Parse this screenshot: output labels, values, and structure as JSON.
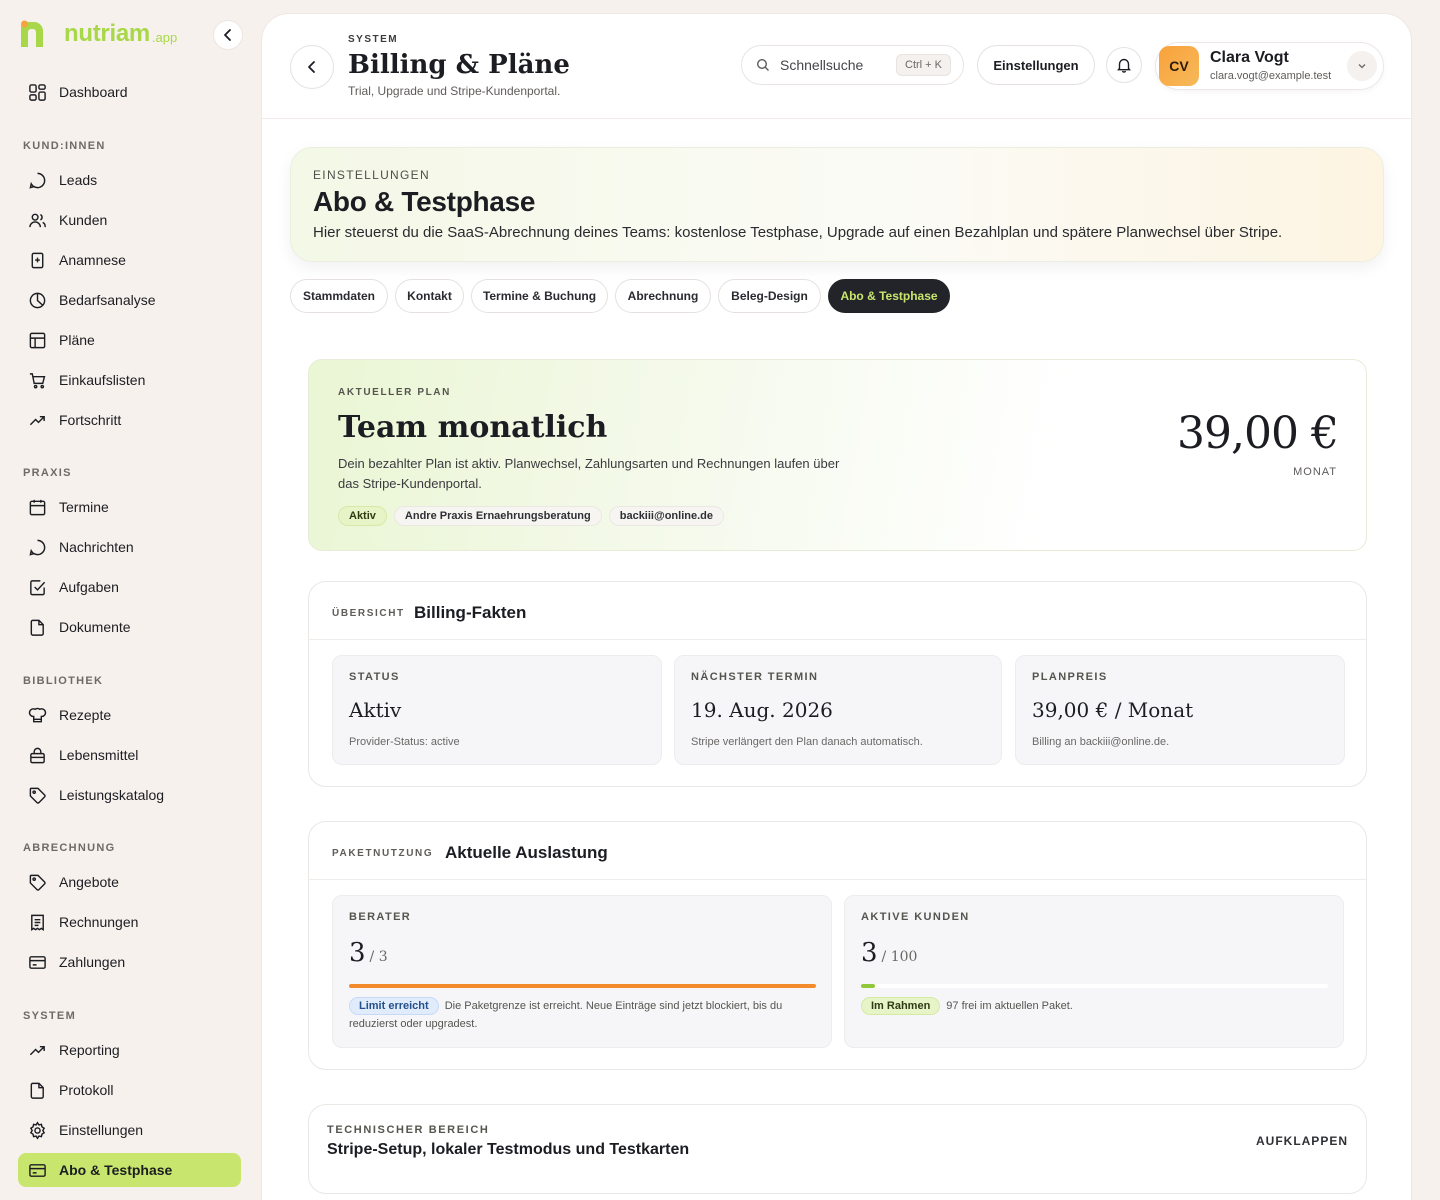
{
  "brand": {
    "name": "nutriam",
    "tld": ".app",
    "color": "#a8d84a"
  },
  "sidebar": {
    "collapse_icon": "chevron-left-icon",
    "groups": [
      {
        "title": "",
        "items": [
          {
            "label": "Dashboard",
            "icon": "dashboard-icon"
          }
        ]
      },
      {
        "title": "KUND:INNEN",
        "items": [
          {
            "label": "Leads",
            "icon": "chat-bubble-icon"
          },
          {
            "label": "Kunden",
            "icon": "users-icon"
          },
          {
            "label": "Anamnese",
            "icon": "clipboard-icon"
          },
          {
            "label": "Bedarfsanalyse",
            "icon": "pie-chart-icon"
          },
          {
            "label": "Pläne",
            "icon": "table-icon"
          },
          {
            "label": "Einkaufslisten",
            "icon": "cart-icon"
          },
          {
            "label": "Fortschritt",
            "icon": "trend-icon"
          }
        ]
      },
      {
        "title": "PRAXIS",
        "items": [
          {
            "label": "Termine",
            "icon": "calendar-icon"
          },
          {
            "label": "Nachrichten",
            "icon": "message-icon"
          },
          {
            "label": "Aufgaben",
            "icon": "checkbox-icon"
          },
          {
            "label": "Dokumente",
            "icon": "document-icon"
          }
        ]
      },
      {
        "title": "BIBLIOTHEK",
        "items": [
          {
            "label": "Rezepte",
            "icon": "chef-hat-icon"
          },
          {
            "label": "Lebensmittel",
            "icon": "shopping-bag-icon"
          },
          {
            "label": "Leistungskatalog",
            "icon": "tag-icon"
          }
        ]
      },
      {
        "title": "ABRECHNUNG",
        "items": [
          {
            "label": "Angebote",
            "icon": "tag-icon"
          },
          {
            "label": "Rechnungen",
            "icon": "receipt-icon"
          },
          {
            "label": "Zahlungen",
            "icon": "credit-card-icon"
          }
        ]
      },
      {
        "title": "SYSTEM",
        "items": [
          {
            "label": "Reporting",
            "icon": "trend-icon"
          },
          {
            "label": "Protokoll",
            "icon": "document-icon"
          },
          {
            "label": "Einstellungen",
            "icon": "gear-icon"
          },
          {
            "label": "Abo & Testphase",
            "icon": "credit-card-icon",
            "active": true
          }
        ]
      }
    ]
  },
  "header": {
    "eyebrow": "SYSTEM",
    "title": "Billing & Pläne",
    "subtitle": "Trial, Upgrade und Stripe-Kundenportal.",
    "search": {
      "placeholder": "Schnellsuche",
      "shortcut": "Ctrl + K"
    },
    "settings_label": "Einstellungen",
    "user": {
      "initials": "CV",
      "name": "Clara Vogt",
      "email": "clara.vogt@example.test"
    }
  },
  "hero": {
    "eyebrow": "EINSTELLUNGEN",
    "title": "Abo & Testphase",
    "description": "Hier steuerst du die SaaS-Abrechnung deines Teams: kostenlose Testphase, Upgrade auf einen Bezahlplan und spätere Planwechsel über Stripe."
  },
  "tabs": [
    {
      "label": "Stammdaten"
    },
    {
      "label": "Kontakt"
    },
    {
      "label": "Termine & Buchung"
    },
    {
      "label": "Abrechnung"
    },
    {
      "label": "Beleg-Design"
    },
    {
      "label": "Abo & Testphase",
      "active": true
    }
  ],
  "plan": {
    "eyebrow": "AKTUELLER PLAN",
    "name": "Team monatlich",
    "description": "Dein bezahlter Plan ist aktiv. Planwechsel, Zahlungsarten und Rechnungen laufen über das Stripe-Kundenportal.",
    "tags": [
      "Aktiv",
      "Andre Praxis Ernaehrungsberatung",
      "backiii@online.de"
    ],
    "price": "39,00 €",
    "price_unit": "MONAT"
  },
  "facts": {
    "eyebrow": "ÜBERSICHT",
    "title": "Billing-Fakten",
    "items": [
      {
        "label": "STATUS",
        "value": "Aktiv",
        "note": "Provider-Status: active"
      },
      {
        "label": "NÄCHSTER TERMIN",
        "value": "19. Aug. 2026",
        "note": "Stripe verlängert den Plan danach automatisch."
      },
      {
        "label": "PLANPREIS",
        "value": "39,00 € / Monat",
        "note": "Billing an backiii@online.de."
      }
    ]
  },
  "usage": {
    "eyebrow": "PAKETNUTZUNG",
    "title": "Aktuelle Auslastung",
    "items": [
      {
        "label": "BERATER",
        "count": "3",
        "max": "/ 3",
        "fraction": 1.0,
        "bar_color": "#f38b2b",
        "status": "Limit erreicht",
        "status_color": "blue",
        "note": "Die Paketgrenze ist erreicht. Neue Einträge sind jetzt blockiert, bis du reduzierst oder upgradest."
      },
      {
        "label": "AKTIVE KUNDEN",
        "count": "3",
        "max": "/ 100",
        "fraction": 0.03,
        "bar_color": "#8fc93a",
        "status": "Im Rahmen",
        "status_color": "green",
        "note": "97 frei im aktuellen Paket."
      }
    ]
  },
  "technical": {
    "eyebrow": "TECHNISCHER BEREICH",
    "title": "Stripe-Setup, lokaler Testmodus und Testkarten",
    "toggle_label": "AUFKLAPPEN"
  }
}
